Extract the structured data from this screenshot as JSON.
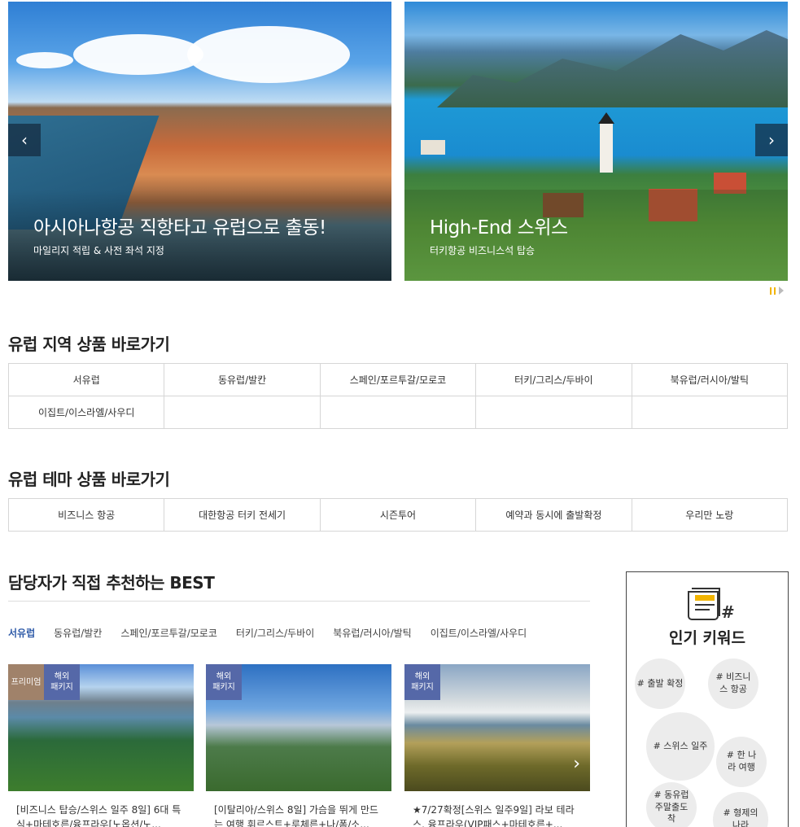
{
  "banners": [
    {
      "title": "아시아나항공 직항타고 유럽으로 출동!",
      "subtitle": "마일리지 적립 & 사전 좌석 지정"
    },
    {
      "title": "High-End 스위스",
      "subtitle": "터키항공 비즈니스석 탑승"
    }
  ],
  "arrows": {
    "prev": "‹",
    "next": "›"
  },
  "region_section": {
    "title": "유럽 지역 상품 바로가기",
    "items": [
      "서유럽",
      "동유럽/발칸",
      "스페인/포르투갈/모로코",
      "터키/그리스/두바이",
      "북유럽/러시아/발틱",
      "이집트/이스라엘/사우디",
      "",
      "",
      "",
      ""
    ]
  },
  "theme_section": {
    "title": "유럽 테마 상품 바로가기",
    "items": [
      "비즈니스 항공",
      "대한항공 터키 전세기",
      "시즌투어",
      "예약과 동시에 출발확정",
      "우리만 노랑"
    ]
  },
  "best_section": {
    "title": "담당자가 직접 추천하는 BEST",
    "tabs": [
      "서유럽",
      "동유럽/발칸",
      "스페인/포르투갈/모로코",
      "터키/그리스/두바이",
      "북유럽/러시아/발틱",
      "이집트/이스라엘/사우디"
    ],
    "active_tab": "서유럽",
    "cards": [
      {
        "badges": [
          "프리미엄",
          "해외\n패키지"
        ],
        "title": "[비즈니스 탑승/스위스 일주 8일] 6대 특식+마테호른/융프라우[노옵션/노..."
      },
      {
        "badges": [
          "해외\n패키지"
        ],
        "title": "[이탈리아/스위스 8일] 가슴을 뛰게 만드는 여행 휘르스트+루체른+나/폼/소..."
      },
      {
        "badges": [
          "해외\n패키지"
        ],
        "title": "★7/27확정[스위스 일주9일] 라보 테라스, 융프라우(VIP패스+마테호른+..."
      }
    ]
  },
  "keywords": {
    "title": "인기 키워드",
    "items": [
      "# 출발 확정",
      "# 비즈니스 항공",
      "# 스위스 일주",
      "# 한 나라 여행",
      "# 동유럽 주말출도착",
      "# 형제의 나라"
    ]
  },
  "colors": {
    "accent": "#2e5aa8",
    "pause": "#f2b400",
    "premium": "#a0826a",
    "package": "#5568a8"
  }
}
